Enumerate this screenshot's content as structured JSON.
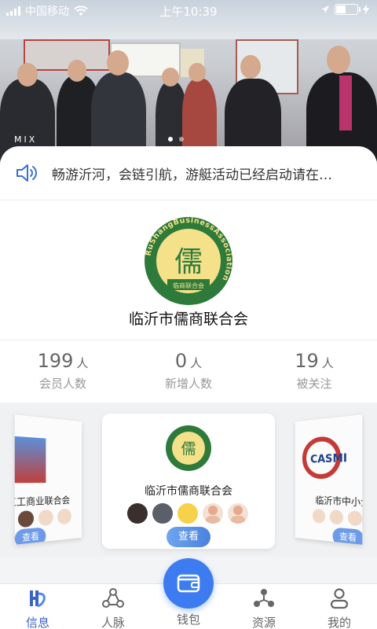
{
  "status_bar": {
    "carrier": "中国移动",
    "time": "上午10:39"
  },
  "banner": {
    "watermark": "MIX",
    "slide_count": 2,
    "active_slide": 1
  },
  "notice": {
    "icon": "speaker-icon",
    "text": "畅游沂河，会链引航，游艇活动已经启动请在…"
  },
  "org": {
    "name": "临沂市儒商联合会",
    "logo_char": "儒",
    "logo_ring_text": "RuShangBusinessAssociation",
    "logo_bottom_text": "临商联合会"
  },
  "stats": [
    {
      "value": "199",
      "unit": "人",
      "label": "会员人数"
    },
    {
      "value": "0",
      "unit": "人",
      "label": "新增人数"
    },
    {
      "value": "19",
      "unit": "人",
      "label": "被关注"
    }
  ],
  "carousel": {
    "left_card": {
      "title": "江工商业联合会",
      "button": "查看"
    },
    "main_card": {
      "title": "临沂市儒商联合会",
      "button": "查看"
    },
    "right_card": {
      "title": "临沂市中小企",
      "logo_text": "CASMI",
      "button": "查看"
    }
  },
  "tabbar": {
    "items": [
      {
        "label": "信息",
        "icon": "info-icon",
        "active": true
      },
      {
        "label": "人脉",
        "icon": "network-icon",
        "active": false
      },
      {
        "label": "钱包",
        "icon": "wallet-icon",
        "active": false
      },
      {
        "label": "资源",
        "icon": "resource-icon",
        "active": false
      },
      {
        "label": "我的",
        "icon": "profile-icon",
        "active": false
      }
    ]
  },
  "colors": {
    "accent": "#3c7cf0",
    "logo_green": "#2e7a3b",
    "logo_gold": "#e8c233",
    "active_tab": "#3b63c8"
  }
}
